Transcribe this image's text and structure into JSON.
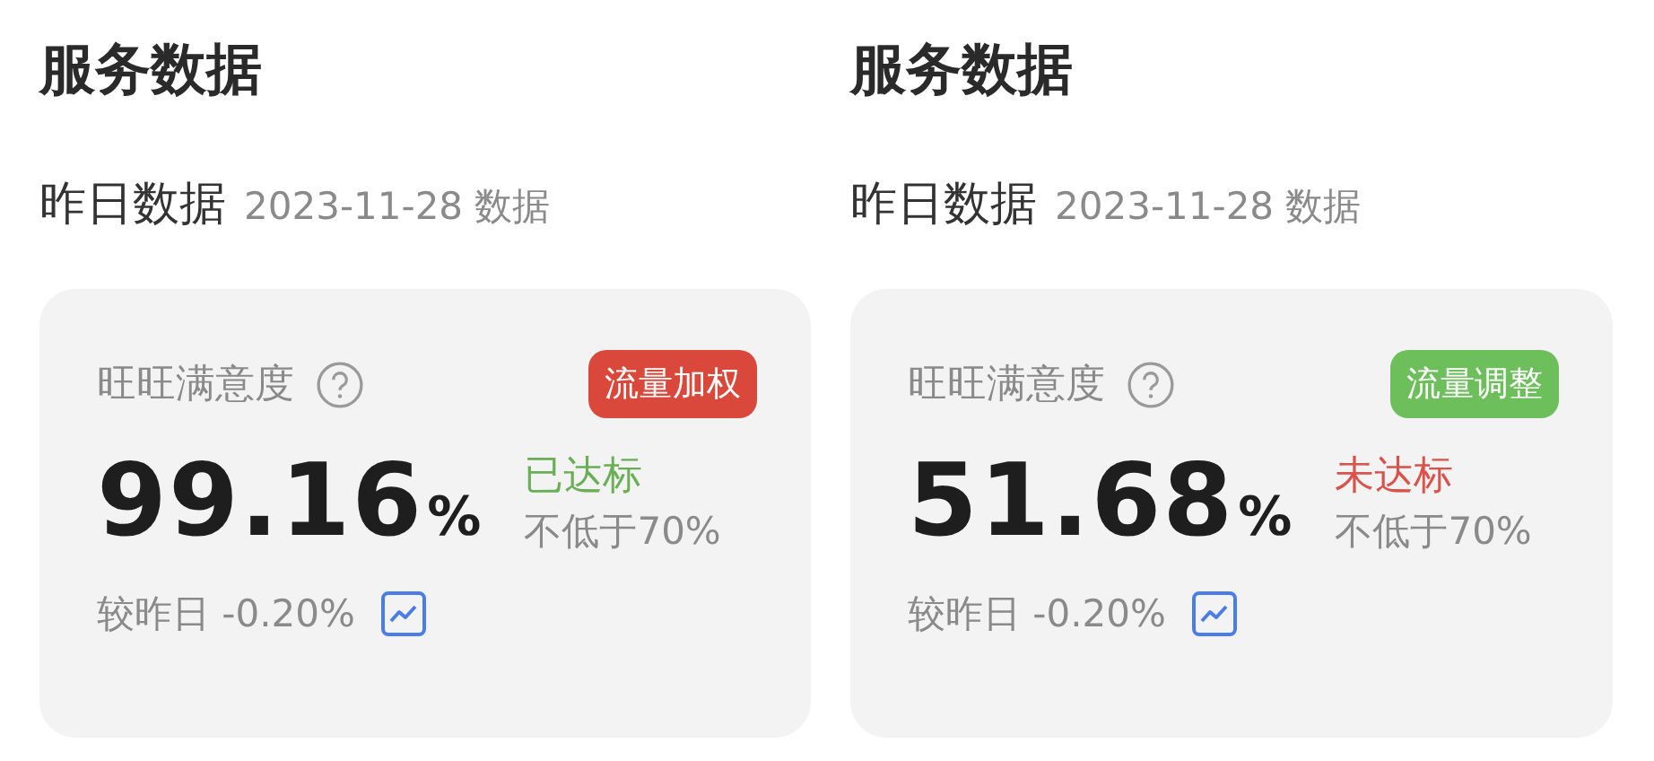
{
  "panels": [
    {
      "title": "服务数据",
      "subtitle": "昨日数据",
      "date": "2023-11-28 数据",
      "card": {
        "label": "旺旺满意度",
        "tag": {
          "text": "流量加权",
          "color": "#d9483b"
        },
        "value": "99.16",
        "unit": "%",
        "status": {
          "text": "已达标",
          "met": true
        },
        "threshold": "不低于70%",
        "compare": "较昨日 -0.20%"
      }
    },
    {
      "title": "服务数据",
      "subtitle": "昨日数据",
      "date": "2023-11-28 数据",
      "card": {
        "label": "旺旺满意度",
        "tag": {
          "text": "流量调整",
          "color": "#6cbf5a"
        },
        "value": "51.68",
        "unit": "%",
        "status": {
          "text": "未达标",
          "met": false
        },
        "threshold": "不低于70%",
        "compare": "较昨日 -0.20%"
      }
    }
  ]
}
